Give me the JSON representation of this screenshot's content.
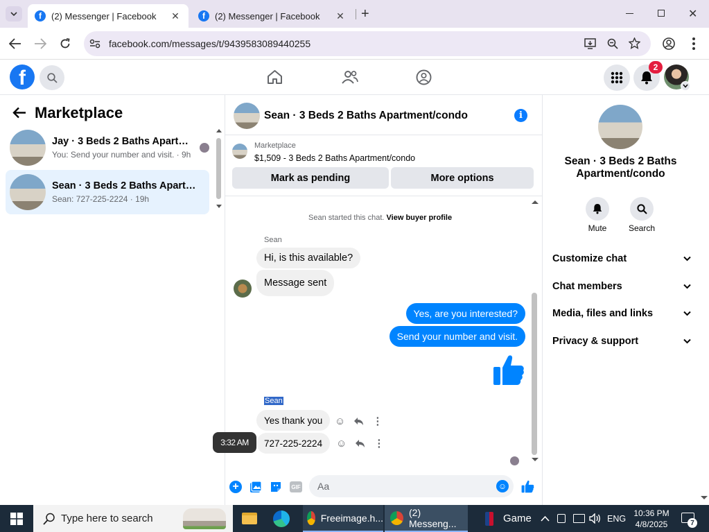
{
  "browser": {
    "tabs": [
      {
        "title": "(2) Messenger | Facebook",
        "active": true
      },
      {
        "title": "(2) Messenger | Facebook",
        "active": false
      }
    ],
    "url": "facebook.com/messages/t/9439583089440255"
  },
  "fb": {
    "notifications_count": "2"
  },
  "left": {
    "title": "Marketplace",
    "conversations": [
      {
        "name": "Jay · 3 Beds 2 Baths Apartment/condo",
        "preview": "You: Send your number and visit. · 9h"
      },
      {
        "name": "Sean · 3 Beds 2 Baths Apartment/condo",
        "preview": "Sean: 727-225-2224 · 19h"
      }
    ]
  },
  "chat": {
    "header_title": "Sean · 3 Beds 2 Baths Apartment/condo",
    "listing_label": "Marketplace",
    "listing_price_title": "$1,509 - 3 Beds 2 Baths Apartment/condo",
    "mark_pending": "Mark as pending",
    "more_options": "More options",
    "started_text": "Sean started this chat.",
    "view_profile": "View buyer profile",
    "sender_label_1": "Sean",
    "sender_label_2": "Sean",
    "messages": [
      {
        "text": "Hi, is this available?",
        "dir": "in"
      },
      {
        "text": "Message sent",
        "dir": "in"
      },
      {
        "text": "Yes, are you interested?",
        "dir": "out"
      },
      {
        "text": "Send your number and visit.",
        "dir": "out"
      },
      {
        "text": "Yes thank you",
        "dir": "in"
      },
      {
        "text": "727-225-2224",
        "dir": "in"
      }
    ],
    "tooltip_time": "3:32 AM",
    "composer_placeholder": "Aa"
  },
  "right": {
    "name": "Sean · 3 Beds 2 Baths Apartment/condo",
    "mute": "Mute",
    "search": "Search",
    "sections": [
      "Customize chat",
      "Chat members",
      "Media, files and links",
      "Privacy & support"
    ]
  },
  "taskbar": {
    "search_placeholder": "Type here to search",
    "apps": [
      "Freeimage.h...",
      "(2) Messeng..."
    ],
    "game": "Game",
    "lang": "ENG",
    "time": "10:36 PM",
    "date": "4/8/2025",
    "notif_count": "7"
  },
  "colors": {
    "fb_blue": "#1877f2",
    "messenger_blue": "#0084ff",
    "selected_bg": "#e6f2fe",
    "taskbar_bg": "#1c2b3a"
  }
}
